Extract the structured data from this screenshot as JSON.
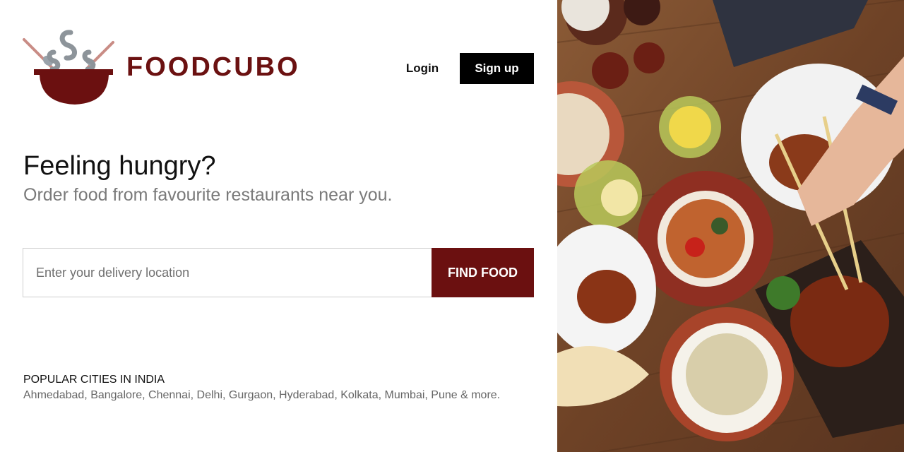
{
  "brand": {
    "name": "FOODCUBO"
  },
  "nav": {
    "login_label": "Login",
    "signup_label": "Sign up"
  },
  "hero": {
    "headline": "Feeling hungry?",
    "subheadline": "Order food from favourite restaurants near you."
  },
  "search": {
    "placeholder": "Enter your delivery location",
    "value": "",
    "button_label": "FIND FOOD"
  },
  "cities": {
    "title": "POPULAR CITIES IN INDIA",
    "items": [
      "Ahmedabad",
      "Bangalore",
      "Chennai",
      "Delhi",
      "Gurgaon",
      "Hyderabad",
      "Kolkata",
      "Mumbai",
      "Pune"
    ],
    "more_label": "& more."
  },
  "colors": {
    "brand": "#6b1111",
    "button_dark": "#000000",
    "find_button": "#6b1010",
    "subtext": "#7a7a7a"
  },
  "icons": [
    "wok-logo-icon",
    "spoon-icon",
    "fork-icon",
    "steam-icon"
  ]
}
